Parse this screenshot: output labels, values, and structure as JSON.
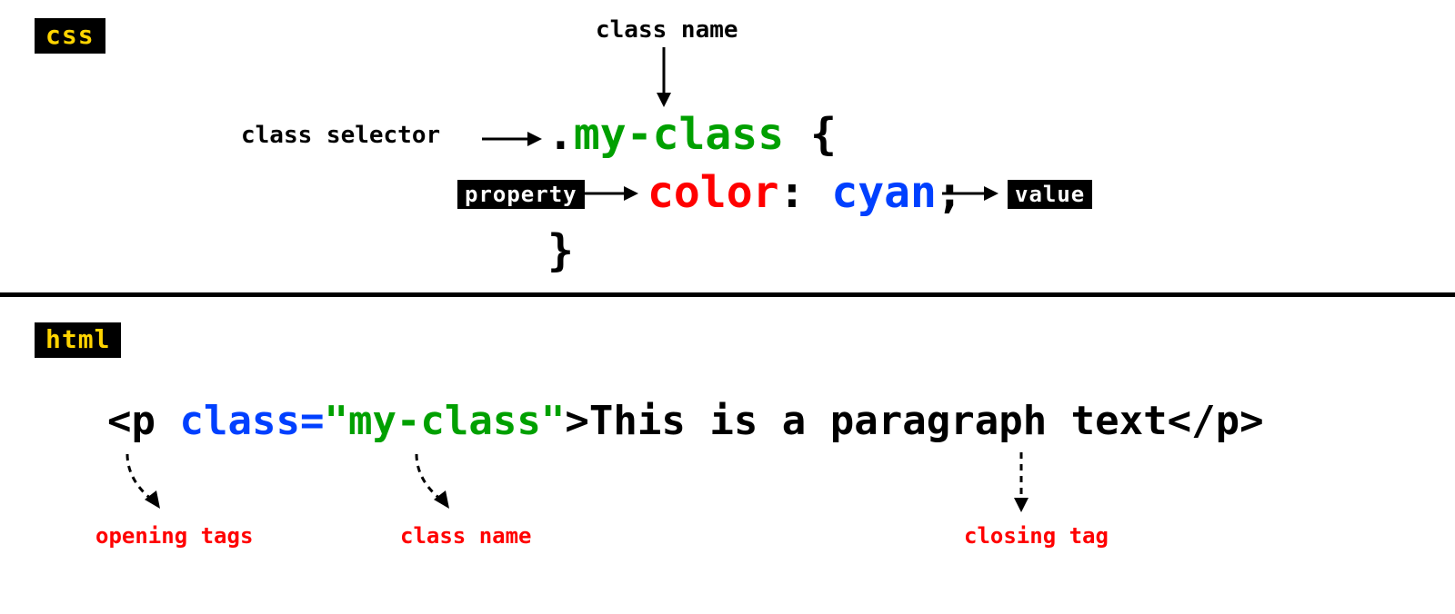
{
  "css": {
    "badge": "css",
    "labels": {
      "class_name": "class name",
      "class_selector": "class selector",
      "property": "property",
      "value": "value"
    },
    "code": {
      "dot": ".",
      "selector": "my-class",
      "brace_open": "{",
      "property": "color",
      "colon": ":",
      "value": "cyan",
      "semicolon": ";",
      "brace_close": "}"
    }
  },
  "html": {
    "badge": "html",
    "labels": {
      "opening_tags": "opening tags",
      "class_name": "class name",
      "closing_tag": "closing tag"
    },
    "code": {
      "open_lt": "<",
      "tag": "p",
      "attr_name": "class",
      "equals": "=",
      "quote": "\"",
      "attr_value": "my-class",
      "open_gt": ">",
      "text": "This is a paragraph text",
      "close": "</p>"
    }
  }
}
